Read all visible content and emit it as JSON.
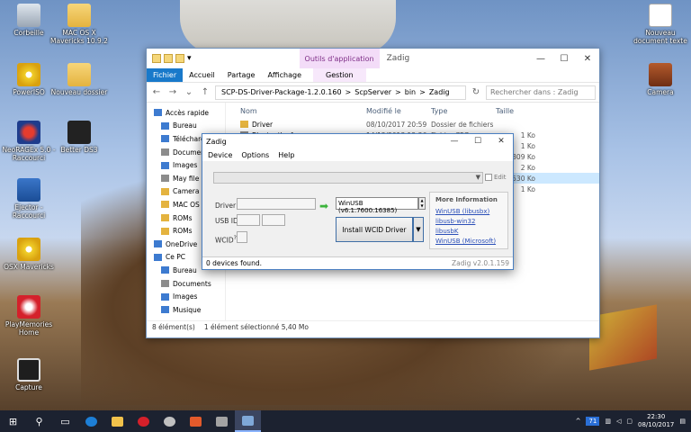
{
  "desktop": {
    "icons": [
      {
        "label": "Corbeille",
        "kind": "recycle-bin"
      },
      {
        "label": "MAC OS X Mavericks 10.9.2",
        "kind": "folder"
      },
      {
        "label": "PowerISO",
        "kind": "disc"
      },
      {
        "label": "Nouveau dossier",
        "kind": "folder"
      },
      {
        "label": "NeoRAGEx 5.0 - Raccourci",
        "kind": "game"
      },
      {
        "label": "Better DS3",
        "kind": "gamepad"
      },
      {
        "label": "Ejector - Raccourci",
        "kind": "network"
      },
      {
        "label": "OSX Mavericks",
        "kind": "disc"
      },
      {
        "label": "PlayMemories Home",
        "kind": "playmemories"
      },
      {
        "label": "Capture",
        "kind": "capture"
      },
      {
        "label": "Nouveau document texte",
        "kind": "document"
      },
      {
        "label": "Camera",
        "kind": "camera"
      }
    ]
  },
  "explorer": {
    "quick_access_toolbar": "▾",
    "context_tab": "Outils d'application",
    "window_title": "Zadig",
    "minimize": "—",
    "maximize": "☐",
    "close": "✕",
    "ribbon": {
      "file": "Fichier",
      "home": "Accueil",
      "share": "Partage",
      "view": "Affichage",
      "manage": "Gestion"
    },
    "address": {
      "path": [
        "SCP-DS-Driver-Package-1.2.0.160",
        "ScpServer",
        "bin",
        "Zadig"
      ],
      "separator": ">"
    },
    "search_placeholder": "Rechercher dans : Zadig",
    "sidebar": [
      {
        "label": "Accès rapide",
        "section": true,
        "icon": "star"
      },
      {
        "label": "Bureau",
        "icon": "desktop"
      },
      {
        "label": "Télécharge",
        "icon": "download"
      },
      {
        "label": "Document",
        "icon": "document"
      },
      {
        "label": "Images",
        "icon": "image"
      },
      {
        "label": "May file (G",
        "icon": "drive"
      },
      {
        "label": "Camera",
        "icon": "folder"
      },
      {
        "label": "MAC OS X",
        "icon": "folder"
      },
      {
        "label": "ROMs",
        "icon": "folder"
      },
      {
        "label": "ROMs",
        "icon": "folder"
      },
      {
        "label": "OneDrive",
        "section": true,
        "icon": "cloud"
      },
      {
        "label": "Ce PC",
        "section": true,
        "icon": "pc"
      },
      {
        "label": "Bureau",
        "icon": "desktop"
      },
      {
        "label": "Documents",
        "icon": "document"
      },
      {
        "label": "Images",
        "icon": "image"
      },
      {
        "label": "Musique",
        "icon": "music"
      }
    ],
    "columns": {
      "name": "Nom",
      "modified": "Modifié le",
      "type": "Type",
      "size": "Taille"
    },
    "rows": [
      {
        "name": "Driver",
        "modified": "08/10/2017 20:59",
        "type": "Dossier de fichiers",
        "size": ""
      },
      {
        "name": "Bluetooth.cfg",
        "modified": "14/12/2013 12:36",
        "type": "Fichier CFG",
        "size": "1 Ko"
      },
      {
        "name": "",
        "modified": "",
        "type": "",
        "size": "1 Ko"
      },
      {
        "name": "",
        "modified": "",
        "type": "",
        "size": "809 Ko"
      },
      {
        "name": "",
        "modified": "",
        "type": "",
        "size": "2 Ko"
      },
      {
        "name": "",
        "modified": "",
        "type": "",
        "size": "5 530 Ko",
        "selected": true
      },
      {
        "name": "",
        "modified": "",
        "type": "",
        "size": "1 Ko"
      }
    ],
    "status": {
      "count": "8 élément(s)",
      "selection": "1 élément sélectionné 5,40 Mo"
    }
  },
  "zadig": {
    "title": "Zadig",
    "minimize": "—",
    "maximize": "☐",
    "close": "✕",
    "menu": [
      "Device",
      "Options",
      "Help"
    ],
    "edit_label": "Edit",
    "driver_label": "Driver",
    "usb_id_label": "USB ID",
    "wcid_label": "WCID",
    "wcid_sup": "?",
    "target_driver": "WinUSB (v6.1.7600.16385)",
    "install_button": "Install WCID Driver",
    "info": {
      "heading": "More Information",
      "links": [
        "WinUSB (libusbx)",
        "libusb-win32",
        "libusbK",
        "WinUSB (Microsoft)"
      ]
    },
    "status": "0 devices found.",
    "version": "Zadig v2.0.1.159"
  },
  "taskbar": {
    "tray": {
      "badge": "71",
      "time": "22:30",
      "date": "08/10/2017"
    }
  }
}
